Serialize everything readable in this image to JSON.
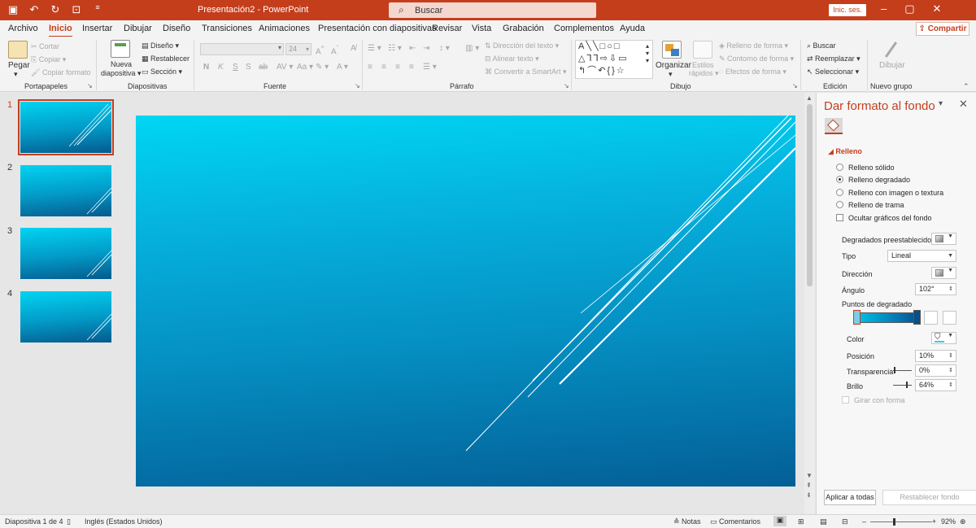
{
  "titlebar": {
    "title": "Presentación2 - PowerPoint",
    "search_placeholder": "Buscar",
    "signin_label": "Inic. ses."
  },
  "tabs": [
    "Archivo",
    "Inicio",
    "Insertar",
    "Dibujar",
    "Diseño",
    "Transiciones",
    "Animaciones",
    "Presentación con diapositivas",
    "Revisar",
    "Vista",
    "Grabación",
    "Complementos",
    "Ayuda"
  ],
  "share_label": "Compartir",
  "ribbon": {
    "clipboard": {
      "paste": "Pegar",
      "cut": "Cortar",
      "copy": "Copiar",
      "format_painter": "Copiar formato",
      "label": "Portapapeles"
    },
    "slides": {
      "new_slide_1": "Nueva",
      "new_slide_2": "diapositiva",
      "layout": "Diseño",
      "reset": "Restablecer",
      "section": "Sección",
      "label": "Diapositivas"
    },
    "font": {
      "size": "24",
      "label": "Fuente",
      "bold": "N",
      "italic": "K",
      "underline": "S",
      "strike": "S",
      "shadow": "ab"
    },
    "paragraph": {
      "text_direction": "Dirección del texto",
      "align_text": "Alinear texto",
      "smartart": "Convertir a SmartArt",
      "label": "Párrafo"
    },
    "drawing": {
      "arrange": "Organizar",
      "quick_styles_1": "Estilos",
      "quick_styles_2": "rápidos",
      "shape_fill": "Relleno de forma",
      "shape_outline": "Contorno de forma",
      "shape_effects": "Efectos de forma",
      "label": "Dibujo"
    },
    "editing": {
      "find": "Buscar",
      "replace": "Reemplazar",
      "select": "Seleccionar",
      "label": "Edición"
    },
    "newgroup": {
      "draw": "Dibujar",
      "label": "Nuevo grupo"
    }
  },
  "slides": [
    {
      "number": "1"
    },
    {
      "number": "2"
    },
    {
      "number": "3"
    },
    {
      "number": "4"
    }
  ],
  "pane": {
    "title": "Dar formato al fondo",
    "section": "Relleno",
    "options": [
      {
        "label": "Relleno sólido",
        "checked": false
      },
      {
        "label": "Relleno degradado",
        "checked": true
      },
      {
        "label": "Relleno con imagen o textura",
        "checked": false
      },
      {
        "label": "Relleno de trama",
        "checked": false
      }
    ],
    "hide_graphics": "Ocultar gráficos del fondo",
    "preset_gradients": "Degradados preestablecidos",
    "type_label": "Tipo",
    "type_value": "Lineal",
    "direction_label": "Dirección",
    "angle_label": "Ángulo",
    "angle_value": "102°",
    "gradient_stops": "Puntos de degradado",
    "color_label": "Color",
    "position_label": "Posición",
    "position_value": "10%",
    "transparency_label": "Transparencia",
    "transparency_value": "0%",
    "brightness_label": "Brillo",
    "brightness_value": "64%",
    "rotate_with_shape": "Girar con forma",
    "apply_all": "Aplicar a todas",
    "reset_background": "Restablecer fondo"
  },
  "status": {
    "slide_info": "Diapositiva 1 de 4",
    "language": "Inglés (Estados Unidos)",
    "notes": "Notas",
    "comments": "Comentarios",
    "zoom": "92%"
  },
  "colors": {
    "accent": "#c43e1c",
    "slide_top": "#00d6f4",
    "slide_bottom": "#035f96"
  }
}
